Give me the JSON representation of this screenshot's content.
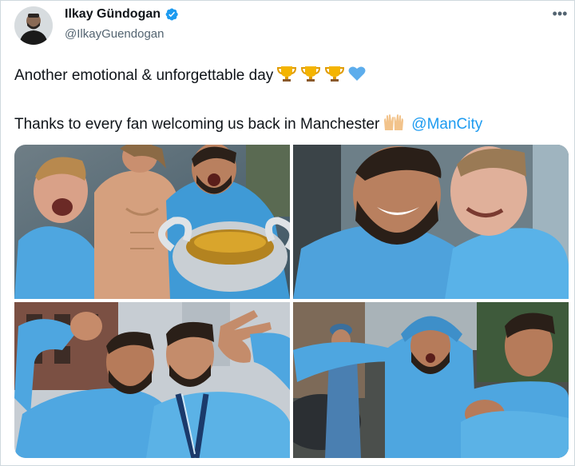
{
  "tweet": {
    "author_name": "Ilkay Gündogan",
    "author_handle": "@IlkayGuendogan",
    "verified": true,
    "more_icon": "•••",
    "line1": "Another emotional & unforgettable day",
    "line1_emojis": [
      "trophy-icon",
      "trophy-icon",
      "trophy-icon",
      "blue-heart-icon"
    ],
    "line2": "Thanks to every fan welcoming us back in Manchester",
    "line2_emoji": "raising-hands-icon",
    "mention": "@ManCity"
  },
  "colors": {
    "text": "#0f1419",
    "secondary": "#536471",
    "link": "#1d9bf0",
    "verified": "#1d9bf0",
    "border": "#cfd9de",
    "city_blue": "#5eb3e8"
  },
  "photos": [
    {
      "id": "photo-1",
      "subject": "players celebrating with trophy"
    },
    {
      "id": "photo-2",
      "subject": "two players laughing"
    },
    {
      "id": "photo-3",
      "subject": "two players posing with medal"
    },
    {
      "id": "photo-4",
      "subject": "players celebrating in street"
    }
  ]
}
